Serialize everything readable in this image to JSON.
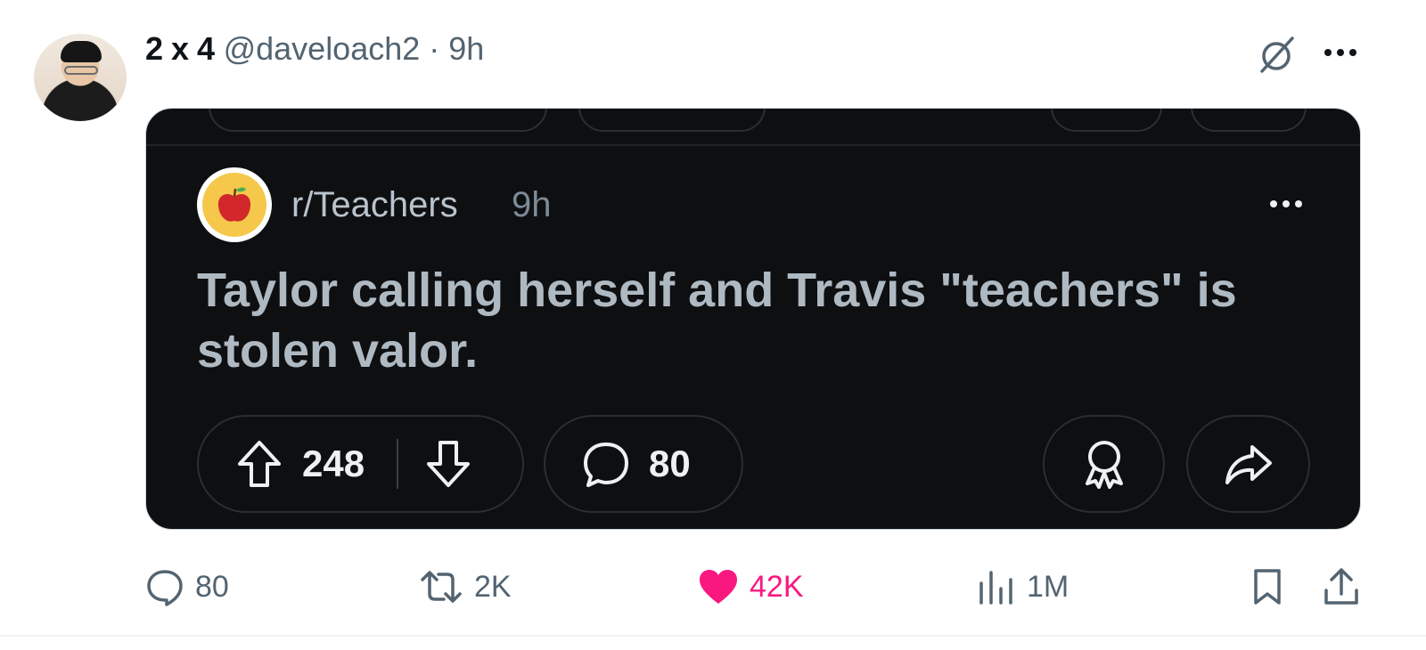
{
  "tweet": {
    "display_name": "2 x 4",
    "handle": "@daveloach2",
    "separator": "·",
    "time": "9h",
    "avatar_icon": "user-avatar",
    "grok_icon": "grok-icon",
    "more_icon": "more-icon"
  },
  "embedded_post": {
    "subreddit": "r/Teachers",
    "time": "9h",
    "icon": "apple-icon",
    "text": "Taylor calling herself and Travis \"teachers\" is stolen valor.",
    "upvotes": "248",
    "comments": "80",
    "colors": {
      "background": "#0d0f11",
      "text": "#aeb9c2",
      "subreddit_icon": "#f5c84c"
    }
  },
  "actions": {
    "replies": "80",
    "reposts": "2K",
    "likes": "42K",
    "views": "1M",
    "colors": {
      "default": "#536471",
      "liked": "#f91880"
    }
  }
}
